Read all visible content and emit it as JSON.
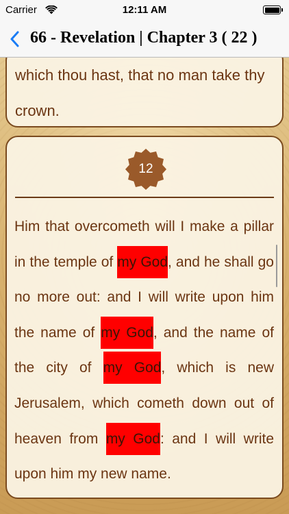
{
  "status_bar": {
    "carrier": "Carrier",
    "time": "12:11 AM",
    "battery_level": 1.0
  },
  "nav": {
    "title": "66 - Revelation | Chapter 3 ( 22 )",
    "back_icon": "chevron-left-icon",
    "accent_color": "#1a7cf5"
  },
  "previous_verse": {
    "text_line1": "which thou hast, that no man take thy",
    "text_line2": "crown."
  },
  "current_verse": {
    "number": "12",
    "segments": [
      {
        "text": "Him that overcometh will I make a pillar in the temple of ",
        "highlight": false
      },
      {
        "text": "my God",
        "highlight": true
      },
      {
        "text": ", and he shall go no more out: and I will write upon him the name of ",
        "highlight": false
      },
      {
        "text": "my God",
        "highlight": true
      },
      {
        "text": ", and the name of the city of ",
        "highlight": false
      },
      {
        "text": "my God",
        "highlight": true
      },
      {
        "text": ", which is new Jerusalem, which cometh down out of heaven from ",
        "highlight": false
      },
      {
        "text": "my God",
        "highlight": true
      },
      {
        "text": ": and I will write upon him my new name.",
        "highlight": false
      }
    ]
  },
  "colors": {
    "text": "#6b3512",
    "highlight": "#ff0000",
    "badge": "#9a5a2a",
    "border": "#7a4a1e"
  }
}
